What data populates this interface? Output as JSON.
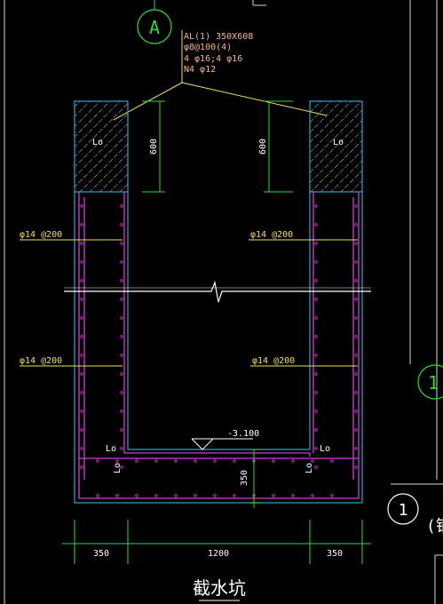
{
  "axis": {
    "grid_a": "A",
    "grid_1_right": "1",
    "grid_1_bottom": "1",
    "partial_char": "(钢"
  },
  "beam_callout": {
    "line1": "AL(1) 350X608",
    "line2": "φ8@100(4)",
    "line3": "4 φ16;4 φ16",
    "line4": "N4 φ12"
  },
  "labels": {
    "lo_tl": "Lo",
    "lo_tr": "Lo",
    "dim600_left": "600",
    "dim600_right": "600",
    "rebar_ul": "φ14 @200",
    "rebar_ur": "φ14 @200",
    "rebar_ll": "φ14 @200",
    "rebar_lr": "φ14 @200",
    "elev": "-3.100",
    "lo_bl": "Lo",
    "lo_br": "Lo",
    "lo_vl": "Lo",
    "lo_vr": "Lo",
    "dim350_v": "350",
    "dim_b1": "350",
    "dim_b2": "1200",
    "dim_b3": "350",
    "title": "截水坑"
  },
  "colors": {
    "background": "#000000",
    "concrete": "#2fa3c8",
    "rebar": "#d43bd8",
    "dim": "#2fdc2f",
    "leader": "#f0e060",
    "callout_text": "#f5b98a",
    "text": "#ffffff",
    "hatch": "#ffffff"
  }
}
